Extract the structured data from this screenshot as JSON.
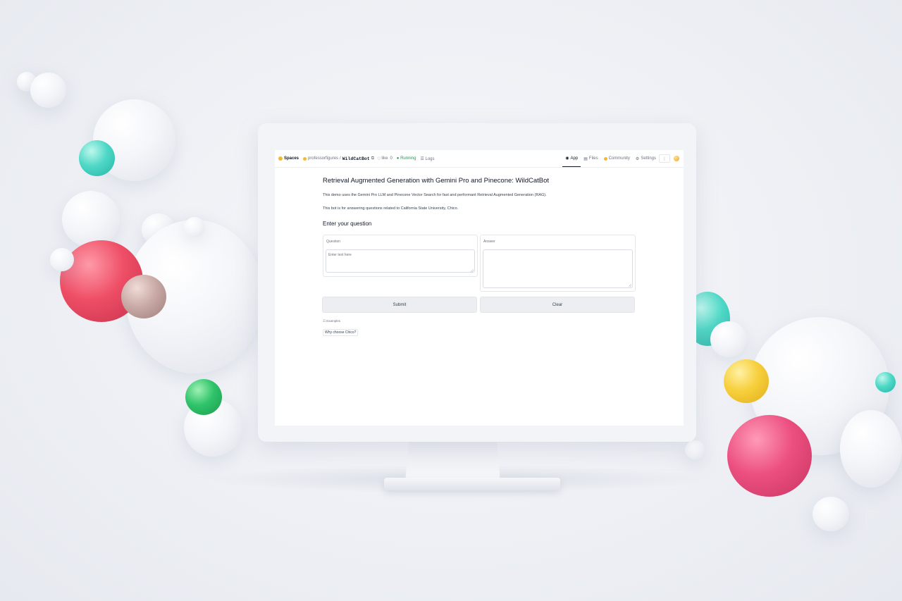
{
  "hub_header": {
    "spaces_label": "Spaces",
    "owner": "professorfigures",
    "app_name": "WildCatBot",
    "like_icon": "heart-icon",
    "like_count": "0",
    "status": "● Running",
    "logs_label": "Logs",
    "nav": [
      {
        "label": "App",
        "icon": "app-icon",
        "active": true
      },
      {
        "label": "Files",
        "icon": "files-icon",
        "active": false
      },
      {
        "label": "Community",
        "icon": "community-icon",
        "active": false
      },
      {
        "label": "Settings",
        "icon": "settings-icon",
        "active": false
      }
    ],
    "more_icon": "⋮",
    "brand_color": "#f5b82e",
    "status_color": "#16a34a"
  },
  "app": {
    "title": "Retrieval Augmented Generation with Gemini Pro and Pinecone: WildCatBot",
    "description_1": "This demo uses the Gemini Pro LLM and Pinecone Vector Search for fast and performant Retrieval Augmented Generation (RAG).",
    "description_2": "This bot is for answering questions related to California State University, Chico.",
    "section_heading": "Enter your question",
    "question": {
      "label": "Question",
      "placeholder": "Enter text here",
      "value": ""
    },
    "answer": {
      "label": "Answer",
      "value": ""
    },
    "submit_label": "Submit",
    "clear_label": "Clear",
    "examples_label": "☷ Examples",
    "example_item": "Why choose Chico?"
  }
}
